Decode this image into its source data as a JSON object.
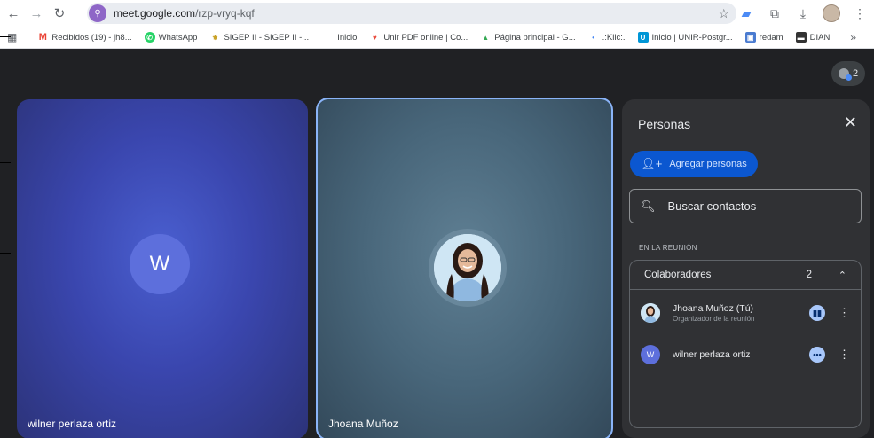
{
  "browser": {
    "url_host": "meet.google.com",
    "url_path": "/rzp-vryq-kqf",
    "icons": [
      "back-arrow-icon",
      "forward-arrow-icon",
      "reload-icon",
      "star-icon",
      "extension-icon",
      "download-icon",
      "menu-icon"
    ]
  },
  "bookmarks": [
    {
      "label": "Recibidos (19) - jh8...",
      "icon": "gmail-icon",
      "color": "#ea4335",
      "glyph": "M"
    },
    {
      "label": "WhatsApp",
      "icon": "whatsapp-icon",
      "color": "#25d366",
      "glyph": "✆"
    },
    {
      "label": "SIGEP II - SIGEP II -...",
      "icon": "sigep-icon",
      "color": "#c9a227",
      "glyph": "⚜"
    },
    {
      "label": "Inicio",
      "icon": "",
      "color": "",
      "glyph": ""
    },
    {
      "label": "Unir PDF online | Co...",
      "icon": "pdf-icon",
      "color": "#e94b3c",
      "glyph": "♥"
    },
    {
      "label": "Página principal - G...",
      "icon": "drive-icon",
      "color": "#34a853",
      "glyph": "▲"
    },
    {
      "label": ".:Klic:.",
      "icon": "klic-icon",
      "color": "#4285f4",
      "glyph": "•"
    },
    {
      "label": "Inicio | UNIR-Postgr...",
      "icon": "unir-icon",
      "color": "#0096d6",
      "glyph": "U"
    },
    {
      "label": "redam",
      "icon": "redam-icon",
      "color": "#4a7bd0",
      "glyph": "▣"
    },
    {
      "label": "DIAN",
      "icon": "dian-icon",
      "color": "#333333",
      "glyph": "▬"
    }
  ],
  "meeting": {
    "participant_count": "2",
    "tiles": [
      {
        "name": "wilner perlaza ortiz",
        "initial": "W"
      },
      {
        "name": "Jhoana Muñoz"
      }
    ]
  },
  "people_panel": {
    "title": "Personas",
    "add_label": "Agregar personas",
    "search_placeholder": "Buscar contactos",
    "section_label": "EN LA REUNIÓN",
    "group_label": "Colaboradores",
    "group_count": "2",
    "members": [
      {
        "name": "Jhoana Muñoz (Tú)",
        "role": "Organizador de la reunión",
        "status": "speaking"
      },
      {
        "name": "wilner perlaza ortiz",
        "initial": "W",
        "status": "more"
      }
    ]
  },
  "colors": {
    "accent": "#0b57d0",
    "active_border": "#8ab4f8",
    "panel_bg": "#303134"
  }
}
